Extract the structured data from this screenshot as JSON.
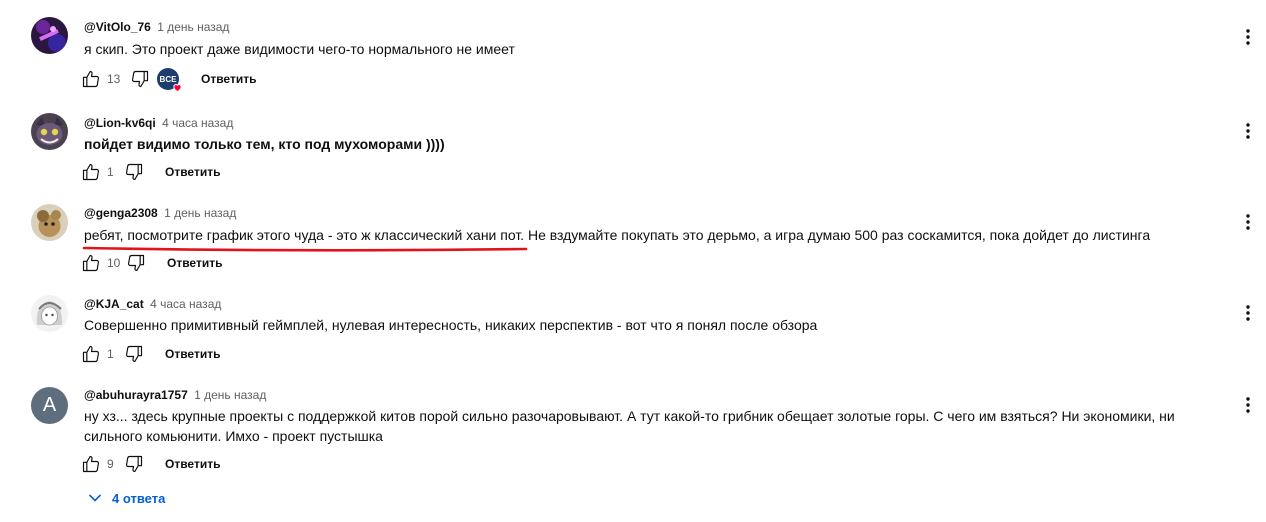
{
  "comments": [
    {
      "author": "@VitOlo_76",
      "time": "1 день назад",
      "text": "я скип. Это проект даже видимости чего-то нормального не имеет",
      "likes": "13",
      "reply_label": "Ответить",
      "creator_heart_label": "BCE"
    },
    {
      "author": "@Lion-kv6qi",
      "time": "4 часа назад",
      "text": "пойдет видимо только тем, кто под мухоморами ))))",
      "likes": "1",
      "reply_label": "Ответить"
    },
    {
      "author": "@genga2308",
      "time": "1 день назад",
      "text": "ребят, посмотрите график этого чуда - это ж классический хани пот. Не вздумайте покупать это дерьмо, а игра думаю 500 раз соскамится, пока дойдет до листинга",
      "likes": "10",
      "reply_label": "Ответить"
    },
    {
      "author": "@KJA_cat",
      "time": "4 часа назад",
      "text": "Совершенно примитивный геймплей, нулевая интересность, никаких перспектив - вот что я понял после обзора",
      "likes": "1",
      "reply_label": "Ответить"
    },
    {
      "author": "@abuhurayra1757",
      "time": "1 день назад",
      "text": "ну хз... здесь крупные проекты с поддержкой китов порой сильно разочаровывают. А тут какой-то грибник обещает золотые горы. С чего им взяться? Ни экономики, ни сильного комьюнити. Имхо - проект пустышка",
      "likes": "9",
      "reply_label": "Ответить",
      "avatar_letter": "A"
    }
  ],
  "replies_toggle": {
    "label": "4 ответа"
  },
  "colors": {
    "accent_blue": "#065fd4",
    "annotation_red": "#e0141e",
    "heart_red": "#ff0033",
    "secondary_text": "#606060"
  }
}
